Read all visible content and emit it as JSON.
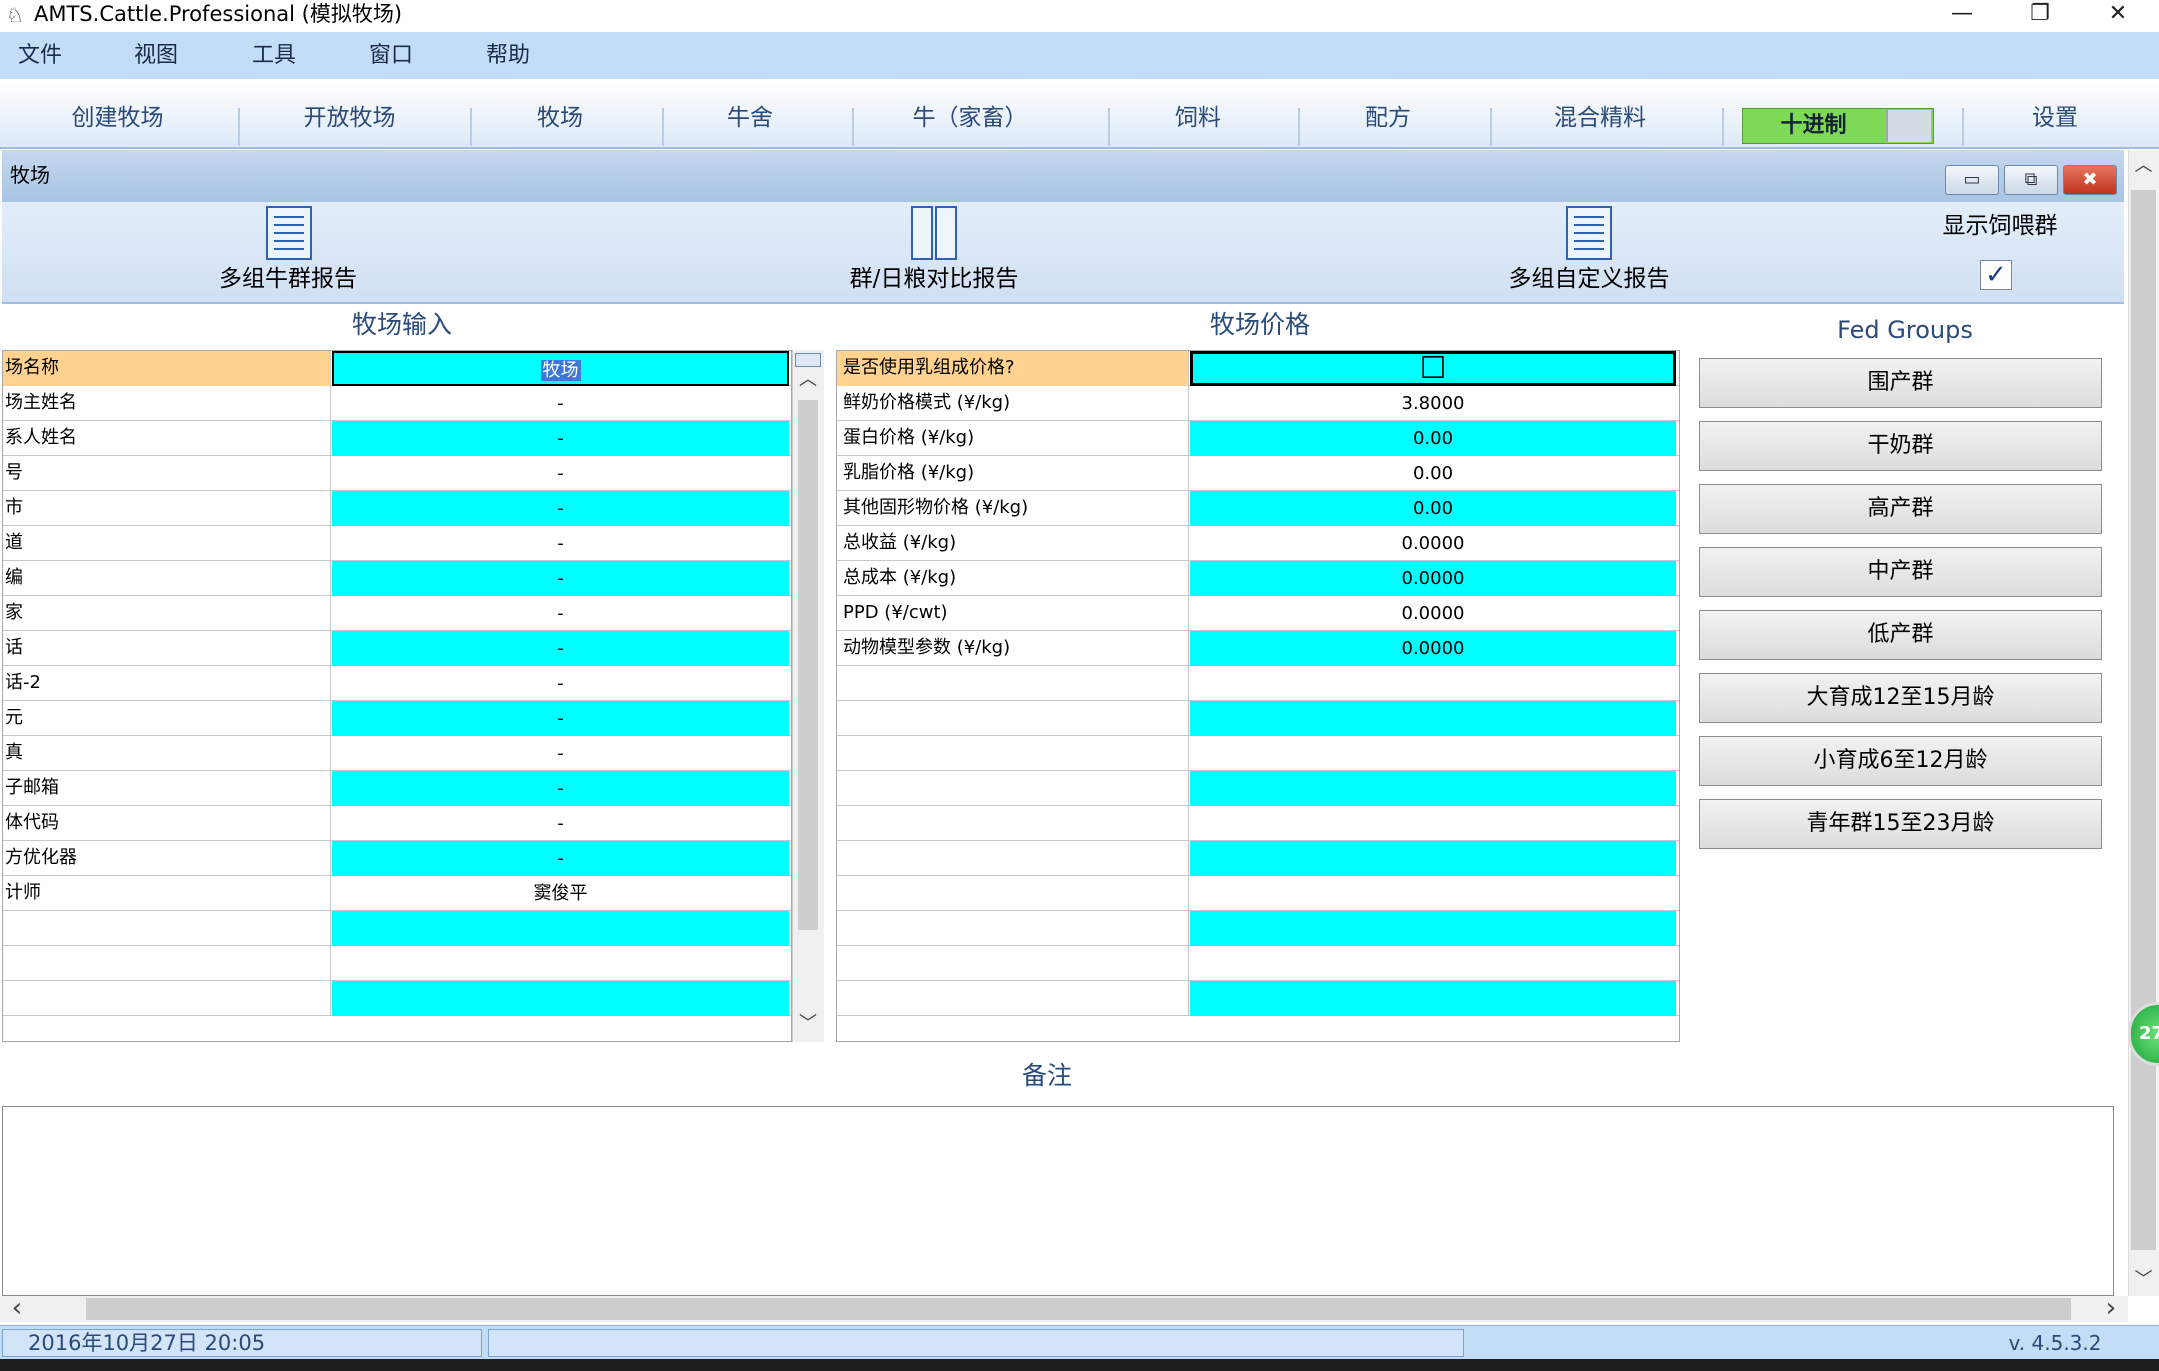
{
  "window": {
    "title": "AMTS.Cattle.Professional (模拟牧场)",
    "minimize": "—",
    "restore": "❐",
    "close": "✕"
  },
  "menu": [
    "文件",
    "视图",
    "工具",
    "窗口",
    "帮助"
  ],
  "ribbon": {
    "tabs": [
      "创建牧场",
      "开放牧场",
      "牧场",
      "牛舍",
      "牛（家畜）",
      "饲料",
      "配方",
      "混合精料"
    ],
    "decimal_label": "十进制",
    "settings_label": "设置"
  },
  "child_window": {
    "title": "牧场",
    "minimize": "▭",
    "restore": "⧉",
    "close": "✖"
  },
  "toolbar": {
    "multi_herd_report": "多组牛群报告",
    "group_ration_report": "群/日粮对比报告",
    "custom_report": "多组自定义报告",
    "show_fed_groups": "显示饲喂群",
    "show_fed_groups_checked": "✓"
  },
  "farm_input": {
    "title": "牧场输入",
    "rows": [
      {
        "label": "场名称",
        "value": "牧场"
      },
      {
        "label": "场主姓名",
        "value": "-"
      },
      {
        "label": "系人姓名",
        "value": "-"
      },
      {
        "label": "号",
        "value": "-"
      },
      {
        "label": "市",
        "value": "-"
      },
      {
        "label": "道",
        "value": "-"
      },
      {
        "label": "编",
        "value": "-"
      },
      {
        "label": "家",
        "value": "-"
      },
      {
        "label": "话",
        "value": "-"
      },
      {
        "label": "话-2",
        "value": "-"
      },
      {
        "label": "元",
        "value": "-"
      },
      {
        "label": "真",
        "value": "-"
      },
      {
        "label": "子邮箱",
        "value": "-"
      },
      {
        "label": "体代码",
        "value": "-"
      },
      {
        "label": "方优化器",
        "value": "-"
      },
      {
        "label": "计师",
        "value": "窦俊平"
      },
      {
        "label": "",
        "value": ""
      },
      {
        "label": "",
        "value": ""
      },
      {
        "label": "",
        "value": ""
      }
    ]
  },
  "farm_price": {
    "title": "牧场价格",
    "rows": [
      {
        "label": "是否使用乳组成价格?",
        "value": "☐"
      },
      {
        "label": "鲜奶价格模式 (¥/kg)",
        "value": "3.8000"
      },
      {
        "label": "蛋白价格 (¥/kg)",
        "value": "0.00"
      },
      {
        "label": "乳脂价格 (¥/kg)",
        "value": "0.00"
      },
      {
        "label": "其他固形物价格 (¥/kg)",
        "value": "0.00"
      },
      {
        "label": "总收益 (¥/kg)",
        "value": "0.0000"
      },
      {
        "label": "总成本 (¥/kg)",
        "value": "0.0000"
      },
      {
        "label": "PPD (¥/cwt)",
        "value": "0.0000"
      },
      {
        "label": "动物模型参数 (¥/kg)",
        "value": "0.0000"
      },
      {
        "label": "",
        "value": ""
      },
      {
        "label": "",
        "value": ""
      },
      {
        "label": "",
        "value": ""
      },
      {
        "label": "",
        "value": ""
      },
      {
        "label": "",
        "value": ""
      },
      {
        "label": "",
        "value": ""
      },
      {
        "label": "",
        "value": ""
      },
      {
        "label": "",
        "value": ""
      },
      {
        "label": "",
        "value": ""
      },
      {
        "label": "",
        "value": ""
      }
    ]
  },
  "fed_groups": {
    "title": "Fed Groups",
    "items": [
      "围产群",
      "干奶群",
      "高产群",
      "中产群",
      "低产群",
      "大育成12至15月龄",
      "小育成6至12月龄",
      "青年群15至23月龄"
    ]
  },
  "notes": {
    "title": "备注"
  },
  "scroll": {
    "up": "︿",
    "down": "﹀",
    "left": "‹",
    "right": "›"
  },
  "status": {
    "datetime": "2016年10月27日   20:05",
    "version": "v. 4.5.3.2"
  },
  "badge": "27",
  "colors": {
    "menu_bg": "#c4ddf6",
    "cyan_cell": "#00ffff",
    "header_row": "#ffd28f",
    "decimal_green": "#7ed957"
  }
}
